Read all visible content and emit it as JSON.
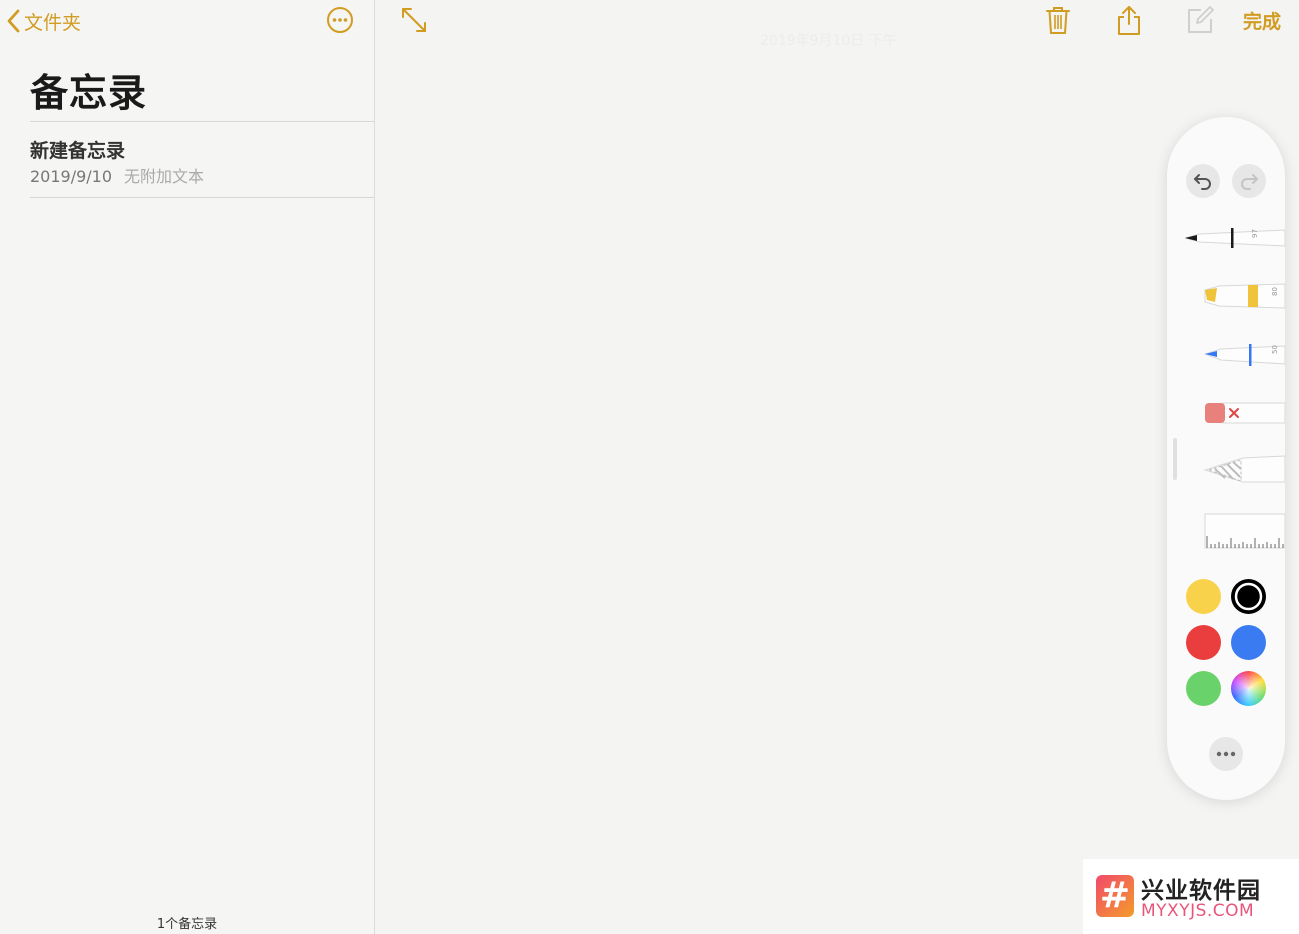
{
  "sidebar": {
    "back_label": "文件夹",
    "title": "备忘录",
    "notes": [
      {
        "title": "新建备忘录",
        "date": "2019/9/10",
        "preview": "无附加文本"
      }
    ],
    "count_label": "1个备忘录"
  },
  "toolbar": {
    "done_label": "完成",
    "faint_date": "2019年9月10日 下午"
  },
  "palette": {
    "tools": [
      {
        "name": "pen",
        "color": "#1a1a1a",
        "size_label": "97"
      },
      {
        "name": "marker",
        "color": "#f0c43a",
        "size_label": "80"
      },
      {
        "name": "pencil",
        "color": "#3478f6",
        "size_label": "50"
      },
      {
        "name": "eraser",
        "color": "#e8807c"
      },
      {
        "name": "lasso",
        "color": "#bdbdbd"
      },
      {
        "name": "ruler",
        "color": "#ffffff"
      }
    ],
    "colors": {
      "yellow": "#f8d24a",
      "black": "#000000",
      "red": "#ea3e3e",
      "blue": "#3a7bf2",
      "green": "#6ad26a"
    },
    "selected_color": "black"
  },
  "accent_color": "#d19c22",
  "watermark": {
    "logo_glyph": "#",
    "name": "兴业软件园",
    "url": "MYXYJS.COM"
  }
}
